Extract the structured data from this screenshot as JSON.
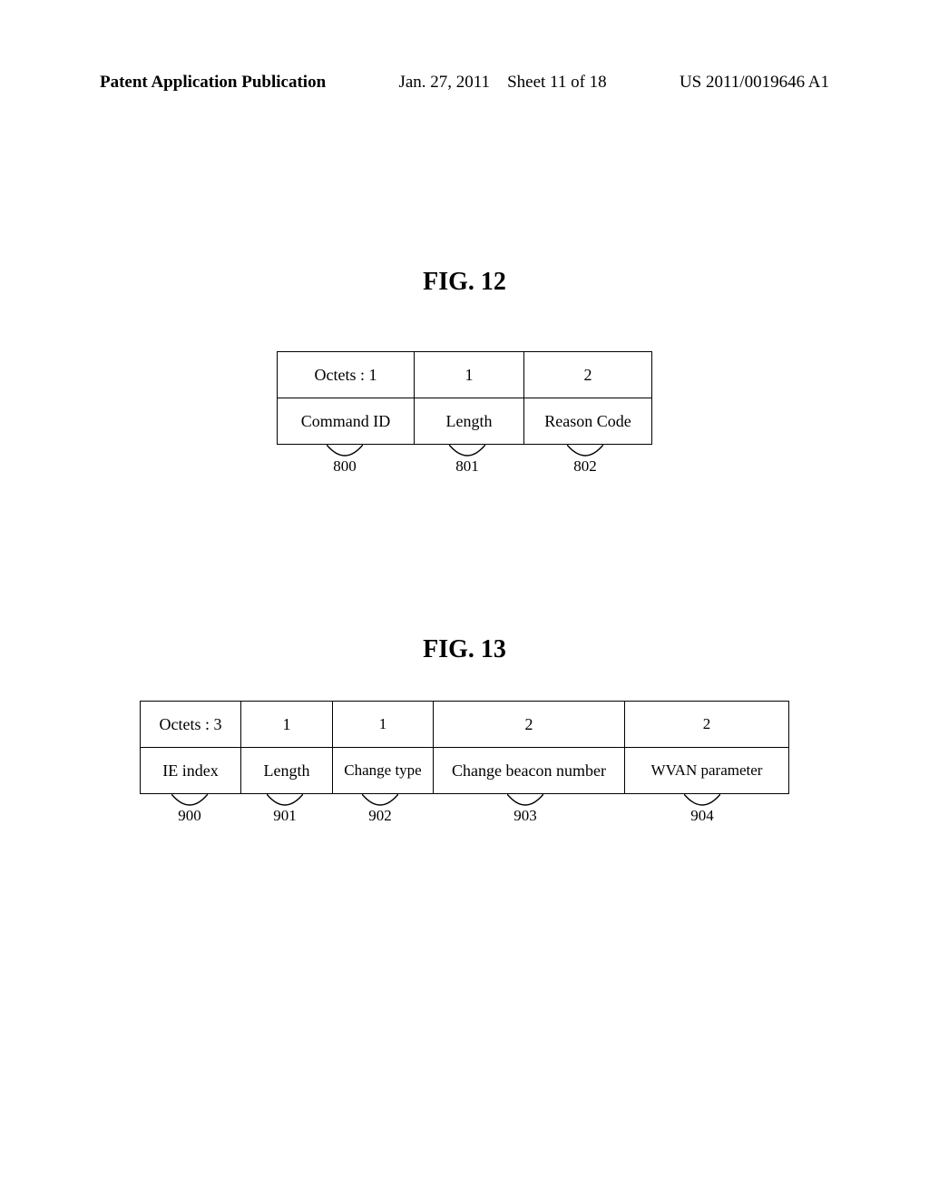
{
  "header": {
    "left": "Patent Application Publication",
    "date": "Jan. 27, 2011",
    "sheet": "Sheet 11 of 18",
    "pubno": "US 2011/0019646 A1"
  },
  "fig12": {
    "title": "FIG. 12",
    "row1": [
      "Octets : 1",
      "1",
      "2"
    ],
    "row2": [
      "Command ID",
      "Length",
      "Reason Code"
    ],
    "refs": [
      "800",
      "801",
      "802"
    ]
  },
  "fig13": {
    "title": "FIG. 13",
    "row1": [
      "Octets : 3",
      "1",
      "1",
      "2",
      "2"
    ],
    "row2": [
      "IE index",
      "Length",
      "Change type",
      "Change beacon number",
      "WVAN parameter"
    ],
    "refs": [
      "900",
      "901",
      "902",
      "903",
      "904"
    ]
  }
}
